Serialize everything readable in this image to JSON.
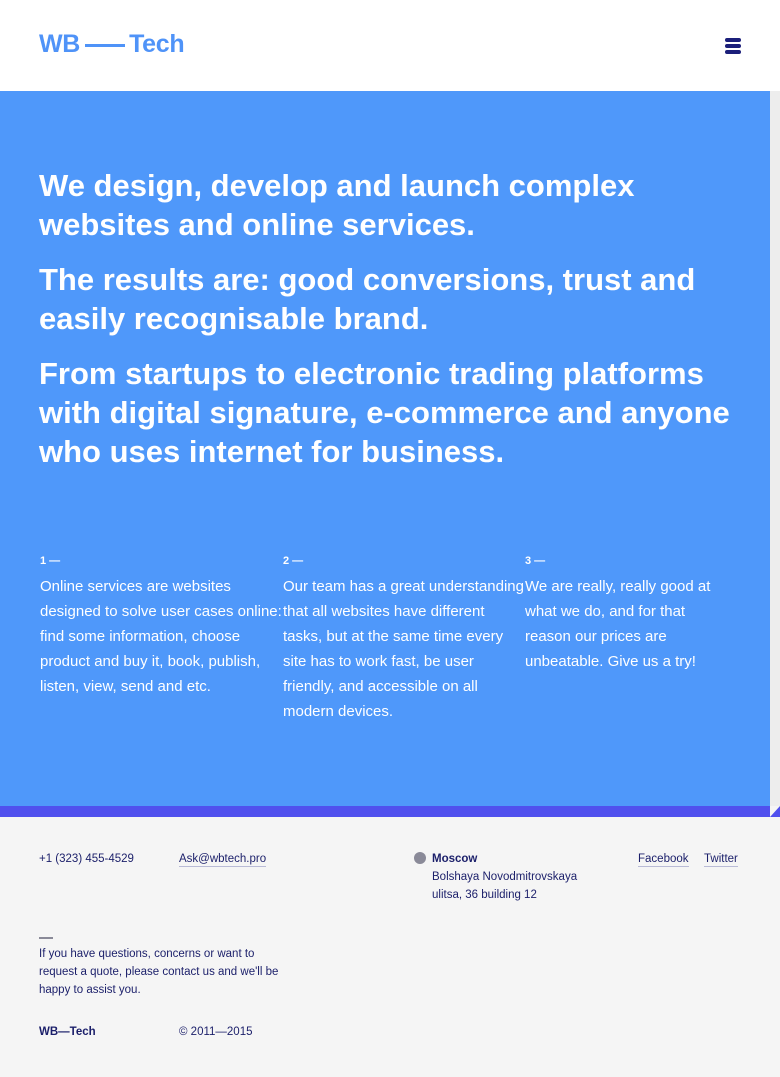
{
  "header": {
    "logo_left": "WB",
    "logo_right": "Tech",
    "menu_icon": "hamburger-menu-icon"
  },
  "hero": {
    "paragraphs": [
      "We design, develop and launch complex websites and online services.",
      "The results are: good conversions, trust and easily recognisable brand.",
      "From startups to electronic trading platforms with digital signature, e-commerce and anyone who uses internet for business."
    ],
    "columns": [
      {
        "num": "1 —",
        "text": "Online services are websites designed to solve user cases online: find some information, choose product and buy it, book, publish, listen, view, send and etc."
      },
      {
        "num": "2 —",
        "text": "Our team has a great understanding that all websites have different tasks, but at the same time every site has to work fast, be user friendly, and accessible on all modern devices."
      },
      {
        "num": "3 —",
        "text": "We are really, really good at what we do, and for that reason our prices are unbeatable. Give us a try!"
      }
    ]
  },
  "footer": {
    "phone": "+1 (323) 455-4529",
    "email": "Ask@wbtech.pro",
    "city": "Moscow",
    "address": "Bolshaya Novodmitrovskaya ulitsa, 36 building 12",
    "location_icon": "location-dot-icon",
    "facebook": "Facebook",
    "twitter": "Twitter",
    "note": "If you have questions, concerns or want to request a quote, please contact us and we'll be happy to assist you.",
    "brand": "WB—Tech",
    "copyright": "© 2011—2015"
  },
  "colors": {
    "accent": "#4f98fa",
    "band": "#5050ee",
    "text_dark": "#1b1f6a",
    "background": "#f5f5f5"
  }
}
